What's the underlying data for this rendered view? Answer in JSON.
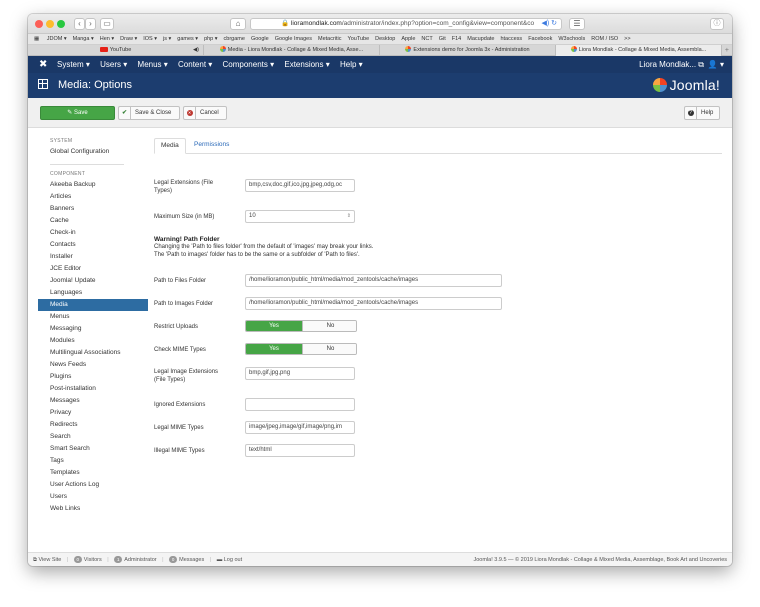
{
  "browser": {
    "url_domain": "lioramondlak.com",
    "url_path": "/administrator/index.php?option=com_config&view=component&co",
    "bookmarks": [
      "JDOM ▾",
      "Manga ▾",
      "Hen ▾",
      "Draw ▾",
      "IOS ▾",
      "js ▾",
      "games ▾",
      "php ▾",
      "cbrgame",
      "Google",
      "Google Images",
      "Metacritic",
      "YouTube",
      "Desktop",
      "Apple",
      "NCT",
      "Git",
      "F14",
      "Macupdate",
      "htaccess",
      "Facebook",
      "W3schools",
      "ROM / ISO",
      ">>"
    ],
    "tabs": [
      {
        "label": "YouTube",
        "icon": "youtube-icon"
      },
      {
        "label": "Media - Liora Mondlak - Collage & Mixed Media, Asse...",
        "icon": "joomla-icon"
      },
      {
        "label": "Extensions demo for Joomla 3x - Administration",
        "icon": "joomla-icon"
      },
      {
        "label": "Liora Mondlak - Collage & Mixed Media, Assembla...",
        "icon": "joomla-icon"
      }
    ]
  },
  "nav": {
    "menu": [
      "System ▾",
      "Users ▾",
      "Menus ▾",
      "Content ▾",
      "Components ▾",
      "Extensions ▾",
      "Help ▾"
    ],
    "user": "Liora Mondlak... ⧉",
    "user_icon": "👤 ▾"
  },
  "header": {
    "title": "Media: Options",
    "brand": "Joomla!"
  },
  "toolbar": {
    "save": "Save",
    "save_close": "Save & Close",
    "cancel": "Cancel",
    "help": "Help"
  },
  "sidebar": {
    "system_heading": "SYSTEM",
    "global_config": "Global Configuration",
    "component_heading": "COMPONENT",
    "items": [
      "Akeeba Backup",
      "Articles",
      "Banners",
      "Cache",
      "Check-in",
      "Contacts",
      "Installer",
      "JCE Editor",
      "Joomla! Update",
      "Languages",
      "Media",
      "Menus",
      "Messaging",
      "Modules",
      "Multilingual Associations",
      "News Feeds",
      "Plugins",
      "Post-installation",
      "Messages",
      "Privacy",
      "Redirects",
      "Search",
      "Smart Search",
      "Tags",
      "Templates",
      "User Actions Log",
      "Users",
      "Web Links"
    ]
  },
  "form": {
    "tabs": [
      "Media",
      "Permissions"
    ],
    "legal_ext_label_1": "Legal Extensions (File",
    "legal_ext_label_2": "Types)",
    "legal_ext_value": "bmp,csv,doc,gif,ico,jpg,jpeg,odg,oc",
    "max_size_label": "Maximum Size (in MB)",
    "max_size_value": "10",
    "warning_title": "Warning! Path Folder",
    "warning_line1": "Changing the 'Path to files folder' from the default of 'images' may break your links.",
    "warning_line2": "The 'Path to images' folder has to be the same or a subfolder of 'Path to files'.",
    "files_path_label": "Path to Files Folder",
    "files_path_value": "/home/lioramon/public_html/media/mod_zentools/cache/images",
    "images_path_label": "Path to Images Folder",
    "images_path_value": "/home/lioramon/public_html/media/mod_zentools/cache/images",
    "restrict_label": "Restrict Uploads",
    "check_mime_label": "Check MIME Types",
    "yes": "Yes",
    "no": "No",
    "legal_img_label_1": "Legal Image Extensions",
    "legal_img_label_2": "(File Types)",
    "legal_img_value": "bmp,gif,jpg,png",
    "ignored_label": "Ignored Extensions",
    "ignored_value": "",
    "legal_mime_label": "Legal MIME Types",
    "legal_mime_value": "image/jpeg,image/gif,image/png,im",
    "illegal_mime_label": "Illegal MIME Types",
    "illegal_mime_value": "text/html"
  },
  "status": {
    "view_site": "View Site",
    "visitors_count": "0",
    "visitors": "Visitors",
    "admin_count": "1",
    "administrator": "Administrator",
    "messages_count": "0",
    "messages": "Messages",
    "logout": "Log out",
    "footer": "Joomla! 3.9.5 — © 2019 Liora Mondlak - Collage & Mixed Media, Assemblage, Book Art and Uncoveries"
  },
  "colors": {
    "nav_bg": "#1a3867",
    "header_bg": "#1c3d6f",
    "save_green": "#46a546",
    "active_blue": "#2d6ca2"
  }
}
